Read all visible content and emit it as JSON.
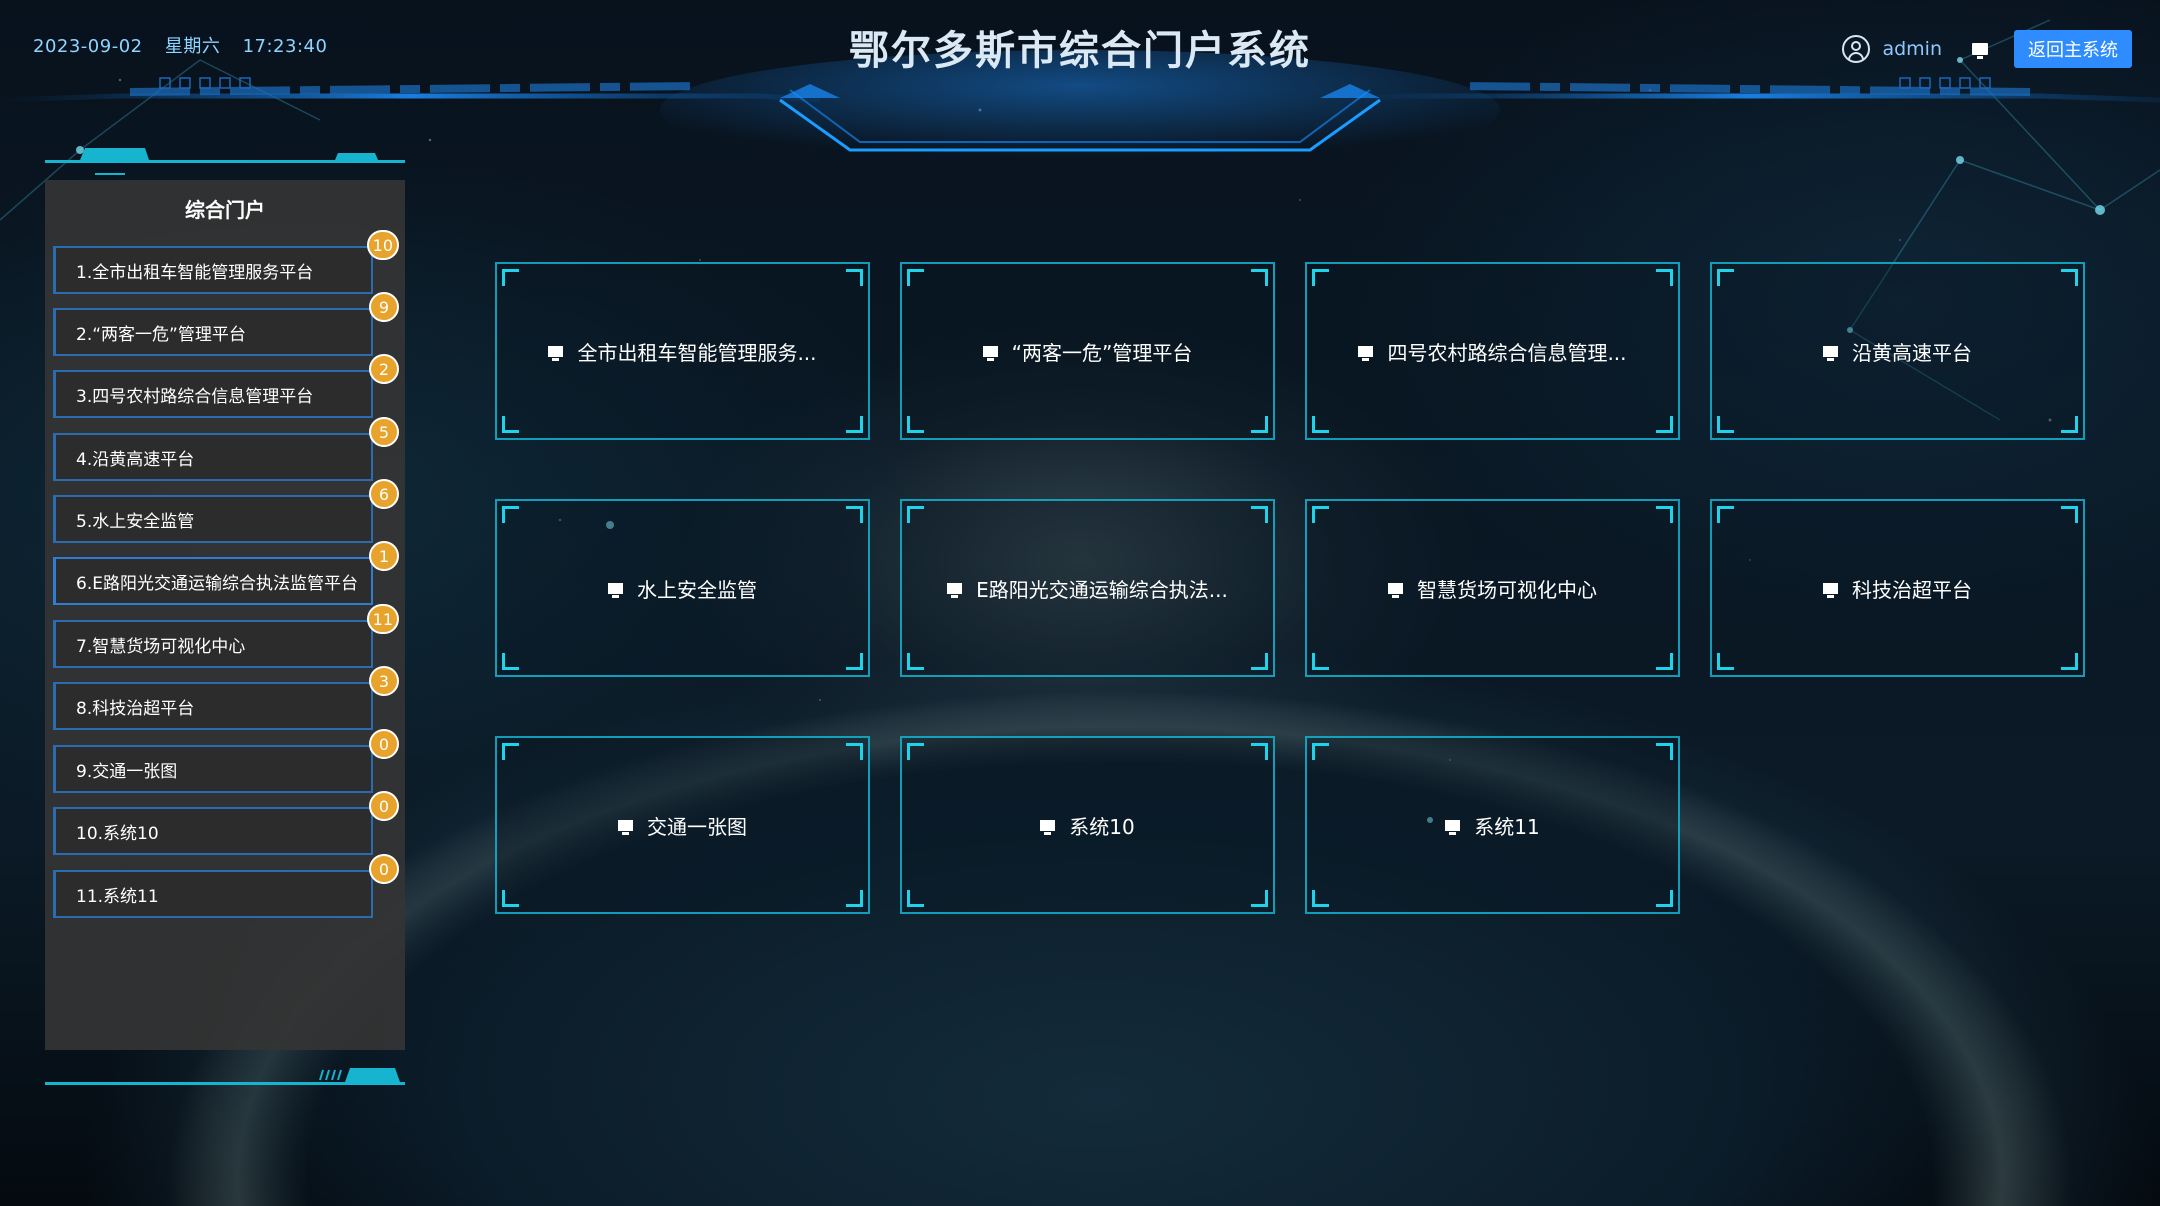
{
  "header": {
    "date": "2023-09-02",
    "weekday": "星期六",
    "time": "17:23:40",
    "title": "鄂尔多斯市综合门户系统",
    "username": "admin",
    "back_button": "返回主系统"
  },
  "sidebar": {
    "title": "综合门户",
    "items": [
      {
        "label": "1.全市出租车智能管理服务平台",
        "count": "10"
      },
      {
        "label": "2.“两客一危”管理平台",
        "count": "9"
      },
      {
        "label": "3.四号农村路综合信息管理平台",
        "count": "2"
      },
      {
        "label": "4.沿黄高速平台",
        "count": "5"
      },
      {
        "label": "5.水上安全监管",
        "count": "6"
      },
      {
        "label": "6.E路阳光交通运输综合执法监管平台",
        "count": "1"
      },
      {
        "label": "7.智慧货场可视化中心",
        "count": "11"
      },
      {
        "label": "8.科技治超平台",
        "count": "3"
      },
      {
        "label": "9.交通一张图",
        "count": "0"
      },
      {
        "label": "10.系统10",
        "count": "0"
      },
      {
        "label": "11.系统11",
        "count": "0"
      }
    ]
  },
  "cards": [
    {
      "label": "全市出租车智能管理服务..."
    },
    {
      "label": "“两客一危”管理平台"
    },
    {
      "label": "四号农村路综合信息管理..."
    },
    {
      "label": "沿黄高速平台"
    },
    {
      "label": "水上安全监管"
    },
    {
      "label": "E路阳光交通运输综合执法..."
    },
    {
      "label": "智慧货场可视化中心"
    },
    {
      "label": "科技治超平台"
    },
    {
      "label": "交通一张图"
    },
    {
      "label": "系统10"
    },
    {
      "label": "系统11"
    }
  ],
  "icons": {
    "user": "user-circle-icon",
    "monitor": "monitor-icon"
  },
  "colors": {
    "accent": "#1fd3ea",
    "button": "#2f8cff",
    "badge": "#e7a32c",
    "menu_border": "#2b6bb0"
  }
}
